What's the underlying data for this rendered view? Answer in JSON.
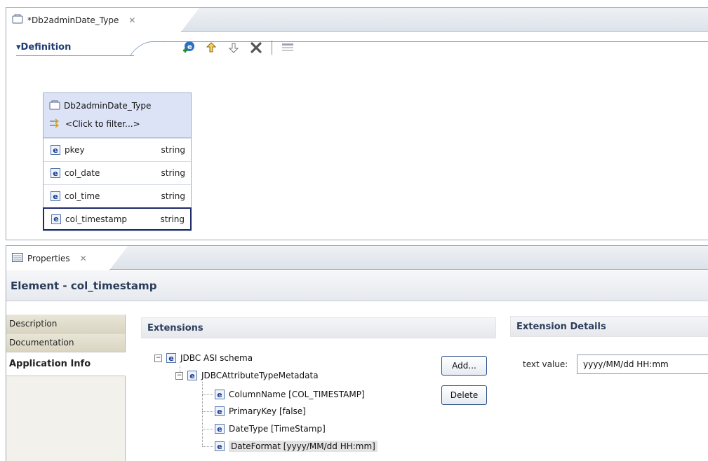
{
  "editor": {
    "tab_title": "*Db2adminDate_Type",
    "tab_close": "✕",
    "section_label": "▾Definition",
    "type_name": "Db2adminDate_Type",
    "filter_text": "<Click to filter...>",
    "fields": [
      {
        "name": "pkey",
        "type": "string"
      },
      {
        "name": "col_date",
        "type": "string"
      },
      {
        "name": "col_time",
        "type": "string"
      },
      {
        "name": "col_timestamp",
        "type": "string"
      }
    ]
  },
  "properties": {
    "tab_title": "Properties",
    "tab_close": "✕",
    "element_title": "Element - col_timestamp",
    "side_tabs": [
      "Description",
      "Documentation",
      "Application Info"
    ],
    "extensions_header": "Extensions",
    "details_header": "Extension Details",
    "tree": {
      "root": "JDBC ASI schema",
      "child": "JDBCAttributeTypeMetadata",
      "leaves": [
        "ColumnName [COL_TIMESTAMP]",
        "PrimaryKey [false]",
        "DateType [TimeStamp]",
        "DateFormat [yyyy/MM/dd HH:mm]"
      ]
    },
    "add_label": "Add...",
    "delete_label": "Delete",
    "text_value_label": "text value:",
    "text_value": "yyyy/MM/dd HH:mm"
  },
  "colors": {
    "accent": "#1e2a6b",
    "type_header_bg": "#dde3f7",
    "title_text": "#2a3c59"
  }
}
